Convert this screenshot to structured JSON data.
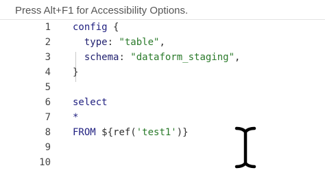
{
  "hint": {
    "text": "Press Alt+F1 for Accessibility Options."
  },
  "editor": {
    "lines": [
      {
        "number": "1",
        "tokens": [
          [
            "config",
            "keyword"
          ],
          [
            " {",
            "punct"
          ]
        ]
      },
      {
        "number": "2",
        "tokens": [
          [
            "  type",
            "key"
          ],
          [
            ": ",
            "punct"
          ],
          [
            "\"table\"",
            "string"
          ],
          [
            ",",
            "punct"
          ]
        ]
      },
      {
        "number": "3",
        "tokens": [
          [
            "  schema",
            "key"
          ],
          [
            ": ",
            "punct"
          ],
          [
            "\"dataform_staging\"",
            "string"
          ],
          [
            ",",
            "punct"
          ]
        ]
      },
      {
        "number": "4",
        "tokens": [
          [
            "}",
            "punct"
          ]
        ]
      },
      {
        "number": "5",
        "tokens": []
      },
      {
        "number": "6",
        "tokens": [
          [
            "select",
            "keyword"
          ]
        ]
      },
      {
        "number": "7",
        "tokens": [
          [
            "*",
            "plain"
          ]
        ]
      },
      {
        "number": "8",
        "tokens": [
          [
            "FROM ",
            "keyword"
          ],
          [
            "${ref(",
            "punct"
          ],
          [
            "'test1'",
            "string"
          ],
          [
            ")}",
            "punct"
          ]
        ]
      },
      {
        "number": "9",
        "tokens": []
      },
      {
        "number": "10",
        "tokens": []
      }
    ]
  },
  "pointer": {
    "icon": "text-cursor-icon"
  }
}
